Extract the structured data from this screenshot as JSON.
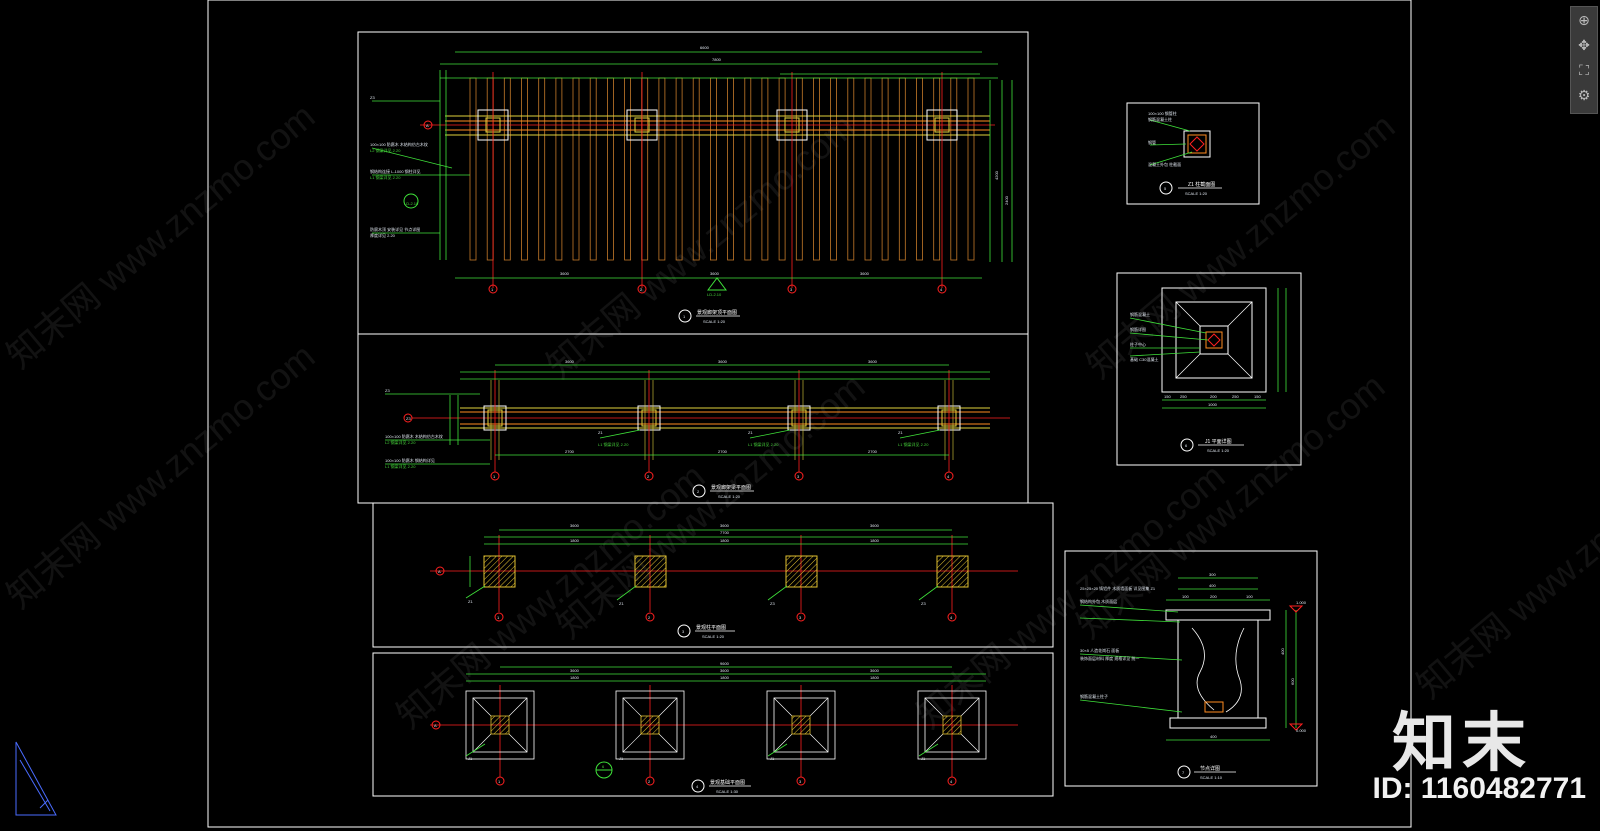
{
  "viewer": {
    "brand": "知末",
    "id_label": "ID: 1160482771",
    "watermark": "知末网 www.znzmo.com",
    "toolbar": {
      "zoom_icon": "zoom-icon",
      "pan_icon": "pan-icon",
      "fit_icon": "fit-icon",
      "mode_icon": "mode-icon"
    }
  },
  "drawing": {
    "colors": {
      "frame": "#ffffff",
      "axis": "#ff2020",
      "slat": "#c57a2a",
      "beam": "#e0d23c",
      "dim": "#3fe23a",
      "text": "#dfe6ef",
      "hatch": "#d8c020"
    },
    "grid_labels": [
      "1",
      "2",
      "3",
      "4"
    ],
    "axis_label": "A",
    "panels": {
      "p1": {
        "number": "1",
        "title": "景观廊架顶平面图",
        "scale": "SCALE 1:20",
        "dims_top": [
          "6600",
          "7800"
        ],
        "dims_bottom": [
          "3600",
          "3600",
          "3600"
        ],
        "dims_right": [
          "4200",
          "2400"
        ],
        "notes": [
          "Z3",
          "100×100 防腐木 木结构仿古木纹",
          "L2 钢梁详见 2.20",
          "钢结构连接 L-1000 钢柱详见",
          "L1 钢梁详见 2.20",
          "防腐木顶 安装详见 节点详图",
          "厚度详见 2.20"
        ],
        "callout": "LD-2.10",
        "section_mark": "LD-2.10"
      },
      "p2": {
        "number": "2",
        "title": "景观廊架梁平面图",
        "scale": "SCALE 1:20",
        "dims_top": [
          "3600",
          "3600",
          "3600"
        ],
        "dims_bottom": [
          "2700",
          "2700",
          "2700"
        ],
        "notes": [
          "Z3",
          "100×100 防腐木 木结构仿古木纹",
          "L2 钢梁详见 2.20",
          "Z1",
          "L1 钢梁详见 2.20",
          "Z1",
          "L1 钢梁详见 2.20",
          "Z1",
          "L1 钢梁详见 2.20",
          "100×100 防腐木 钢结构详见",
          "L1 钢梁详见 2.20"
        ]
      },
      "p3": {
        "number": "3",
        "title": "景观柱平面图",
        "scale": "SCALE 1:20",
        "dims_top": [
          "3600",
          "3600",
          "3600"
        ],
        "dims_total": "7700",
        "dims_mid": [
          "1800",
          "1800",
          "1800"
        ],
        "notes": [
          "Z1",
          "Z1",
          "Z3",
          "Z3"
        ]
      },
      "p4": {
        "number": "4",
        "title": "景观基础平面图",
        "scale": "SCALE 1:30",
        "dims_top": [
          "3600",
          "3600",
          "3600"
        ],
        "dims_total": "9600",
        "dims_mid": [
          "1800",
          "1800",
          "1800"
        ],
        "notes": [
          "J1",
          "J1",
          "J1",
          "J1"
        ],
        "callout": "6"
      },
      "p5": {
        "number": "5",
        "title": "Z1 柱截面图",
        "scale": "SCALE 1:20",
        "notes": [
          "100×100 钢管柱",
          "钢筋混凝土柱",
          "钢管",
          "混凝土外包 柱截面"
        ]
      },
      "p6": {
        "number": "6",
        "title": "J1 平面详图",
        "scale": "SCALE 1:20",
        "notes": [
          "钢筋混凝土",
          "钢筋详图",
          "柱子中心",
          "基础 C30混凝土"
        ],
        "dims_bottom": [
          "150",
          "250",
          "200",
          "250",
          "150"
        ],
        "dims_total": "1000"
      },
      "p7": {
        "number": "7",
        "title": "节点详图",
        "scale": "SCALE 1:10",
        "dims_top": [
          "300",
          "400",
          "100",
          "200",
          "100"
        ],
        "dims_right": [
          "400",
          "600"
        ],
        "dims_bottom": "400",
        "levels": [
          "1.000",
          "0.000"
        ],
        "notes": [
          "25×25×20 铸铝件 木质墙面板 详见图集 Z1",
          "钢结构外包 木质面层",
          "30×5 人造花岗石 面板",
          "装饰面层材料 厚度 规格详见 统一",
          "钢筋混凝土柱子"
        ]
      }
    }
  }
}
